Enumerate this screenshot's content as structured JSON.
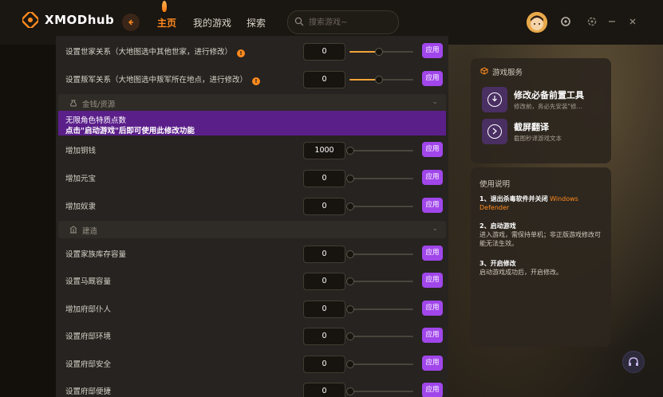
{
  "app": {
    "name": "XMODhub"
  },
  "nav": {
    "items": [
      "主页",
      "我的游戏",
      "探索"
    ],
    "active": "主页"
  },
  "search": {
    "placeholder": "搜索游戏~"
  },
  "rows_top": [
    {
      "label": "设置世家关系（大地图选中其他世家，进行修改）",
      "has_info": true,
      "value": "0",
      "slider_pct": 45,
      "apply": "应用"
    },
    {
      "label": "设置叛军关系（大地图选中叛军所在地点，进行修改）",
      "has_info": true,
      "value": "0",
      "slider_pct": 45,
      "apply": "应用"
    }
  ],
  "sections": {
    "money": {
      "label": "金钱/资源",
      "icon": "coin-bag-icon"
    },
    "build": {
      "label": "建造",
      "icon": "building-icon"
    }
  },
  "notice": {
    "line1": "无限角色特质点数",
    "line2": "点击\"启动游戏\"后即可使用此修改功能"
  },
  "rows_money": [
    {
      "label": "增加铜钱",
      "value": "1000",
      "slider_pct": 0,
      "apply": "应用"
    },
    {
      "label": "增加元宝",
      "value": "0",
      "slider_pct": 0,
      "apply": "应用"
    },
    {
      "label": "增加奴隶",
      "value": "0",
      "slider_pct": 0,
      "apply": "应用"
    }
  ],
  "rows_build": [
    {
      "label": "设置家族库存容量",
      "value": "0",
      "slider_pct": 0,
      "apply": "应用"
    },
    {
      "label": "设置马厩容量",
      "value": "0",
      "slider_pct": 0,
      "apply": "应用"
    },
    {
      "label": "增加府邸仆人",
      "value": "0",
      "slider_pct": 0,
      "apply": "应用"
    },
    {
      "label": "设置府邸环境",
      "value": "0",
      "slider_pct": 0,
      "apply": "应用"
    },
    {
      "label": "设置府邸安全",
      "value": "0",
      "slider_pct": 0,
      "apply": "应用"
    },
    {
      "label": "设置府邸便捷",
      "value": "0",
      "slider_pct": 0,
      "apply": "应用"
    }
  ],
  "services": {
    "title": "游戏服务",
    "items": [
      {
        "name": "修改必备前置工具",
        "desc": "修改前，务必先安装\"修...",
        "icon": "download-icon"
      },
      {
        "name": "截屏翻译",
        "desc": "截图秒译游戏文本",
        "icon": "translate-icon"
      }
    ]
  },
  "guide": {
    "title": "使用说明",
    "steps": [
      {
        "heading": "1、退出杀毒软件并关闭",
        "highlight": "Windows Defender",
        "body": ""
      },
      {
        "heading": "2、启动游戏",
        "highlight": "",
        "body": "进入游戏，需保持单机；非正版游戏修改可能无法生效。"
      },
      {
        "heading": "3、开启修改",
        "highlight": "",
        "body": "启动游戏成功后，开启修改。"
      }
    ]
  },
  "colors": {
    "accent": "#ff8a1f",
    "apply_button": "#a046ea",
    "notice_bg": "#5b1f8a"
  }
}
